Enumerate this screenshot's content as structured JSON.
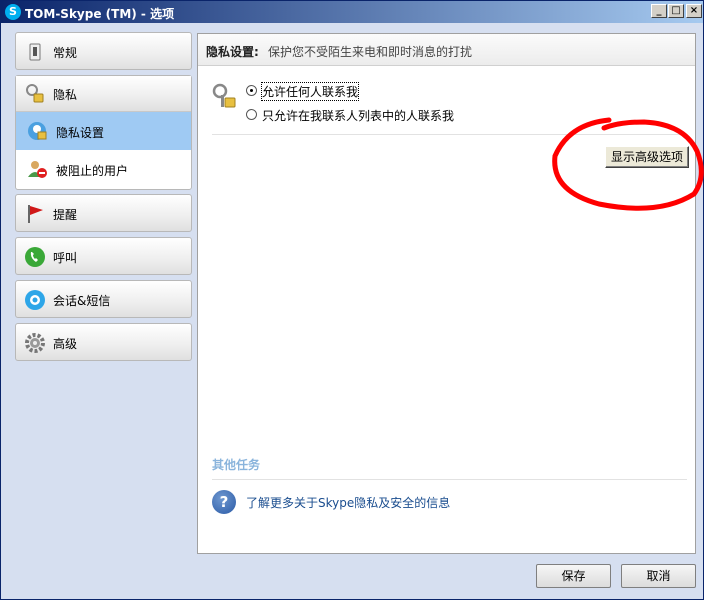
{
  "window": {
    "title": "TOM-Skype (TM) - 选项",
    "min": "_",
    "max": "□",
    "close": "×"
  },
  "sidebar": {
    "items": [
      {
        "label": "常规",
        "icon": "switch-icon"
      },
      {
        "label": "隐私",
        "icon": "key-lock-icon"
      },
      {
        "label": "隐私设置",
        "icon": "privacy-settings-icon"
      },
      {
        "label": "被阻止的用户",
        "icon": "blocked-user-icon"
      },
      {
        "label": "提醒",
        "icon": "red-flag-icon"
      },
      {
        "label": "呼叫",
        "icon": "phone-icon"
      },
      {
        "label": "会话&短信",
        "icon": "chat-icon"
      },
      {
        "label": "高级",
        "icon": "gear-icon"
      }
    ]
  },
  "panel": {
    "title": "隐私设置:",
    "desc": "保护您不受陌生来电和即时消息的打扰",
    "radio_any": "允许任何人联系我",
    "radio_contacts": "只允许在我联系人列表中的人联系我",
    "advanced_button": "显示高级选项",
    "other_tasks": "其他任务",
    "help_link": "了解更多关于Skype隐私及安全的信息",
    "help_glyph": "?"
  },
  "footer": {
    "save": "保存",
    "cancel": "取消"
  },
  "colors": {
    "accent": "#9fcaf3",
    "annotation": "#ff0000",
    "link": "#1a4d8f"
  }
}
